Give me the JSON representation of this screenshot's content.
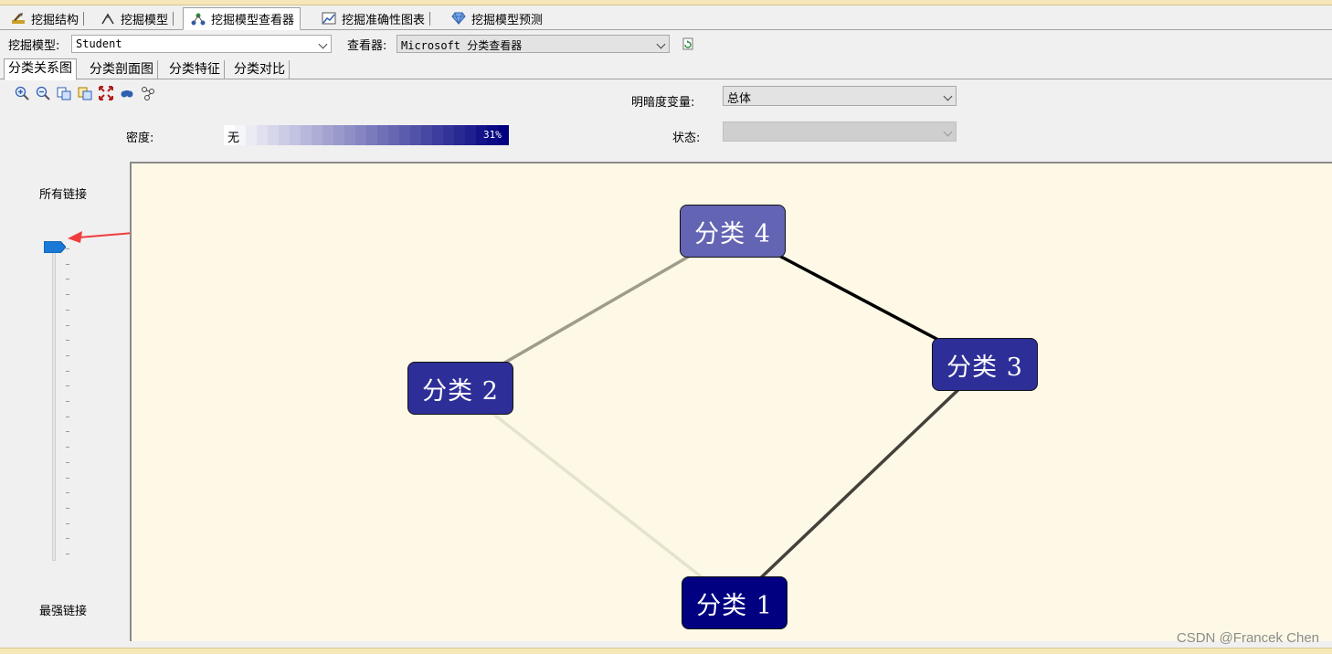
{
  "tabs": [
    {
      "label": "挖掘结构",
      "icon": "mining-structure-icon"
    },
    {
      "label": "挖掘模型",
      "icon": "mining-model-icon"
    },
    {
      "label": "挖掘模型查看器",
      "icon": "model-viewer-icon",
      "active": true
    },
    {
      "label": "挖掘准确性图表",
      "icon": "accuracy-chart-icon"
    },
    {
      "label": "挖掘模型预测",
      "icon": "prediction-icon"
    }
  ],
  "model_selector": {
    "label": "挖掘模型:",
    "value": "Student"
  },
  "viewer_selector": {
    "label": "查看器:",
    "value": "Microsoft 分类查看器"
  },
  "sub_tabs": [
    {
      "label": "分类关系图",
      "active": true
    },
    {
      "label": "分类剖面图"
    },
    {
      "label": "分类特征"
    },
    {
      "label": "分类对比"
    }
  ],
  "toolbar_icons": [
    "zoom-in-icon",
    "zoom-out-icon",
    "copy-icon",
    "copy-graph-icon",
    "fit-to-window-icon",
    "find-node-icon",
    "layout-icon"
  ],
  "shading": {
    "label": "明暗度变量:",
    "value": "总体"
  },
  "state": {
    "label": "状态:",
    "value": ""
  },
  "density": {
    "label": "密度:",
    "min_label": "无",
    "max_label": "31%"
  },
  "link_slider": {
    "top_label": "所有链接",
    "bottom_label": "最强链接",
    "value": 1.0
  },
  "clusters": [
    {
      "id": "c4",
      "label": "分类 4",
      "color": "#6464b4"
    },
    {
      "id": "c3",
      "label": "分类 3",
      "color": "#2e2e98"
    },
    {
      "id": "c2",
      "label": "分类 2",
      "color": "#2e2e98"
    },
    {
      "id": "c1",
      "label": "分类 1",
      "color": "#000080"
    }
  ],
  "links": [
    {
      "from": "c4",
      "to": "c3",
      "color": "#000000"
    },
    {
      "from": "c3",
      "to": "c1",
      "color": "#45413a"
    },
    {
      "from": "c4",
      "to": "c2",
      "color": "#9e9d8c"
    },
    {
      "from": "c2",
      "to": "c1",
      "color": "#e6e3cc"
    }
  ],
  "watermark": "CSDN @Francek Chen"
}
